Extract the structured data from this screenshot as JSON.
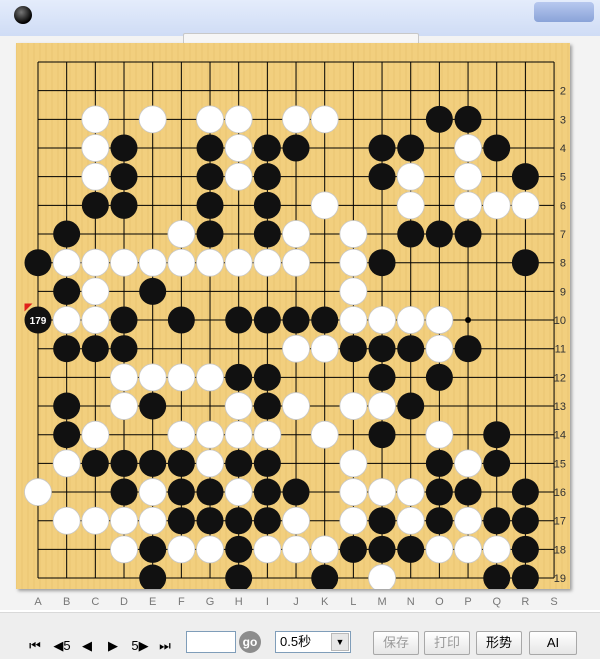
{
  "board": {
    "size": 19,
    "col_labels": [
      "A",
      "B",
      "C",
      "D",
      "E",
      "F",
      "G",
      "H",
      "I",
      "J",
      "K",
      "L",
      "M",
      "N",
      "O",
      "P",
      "Q",
      "R",
      "S"
    ],
    "row_labels_right": [
      "2",
      "3",
      "4",
      "5",
      "6",
      "7",
      "8",
      "9",
      "10",
      "11",
      "12",
      "13",
      "14",
      "15",
      "16",
      "17",
      "18",
      "19"
    ],
    "last_move_label": "179",
    "last_move": {
      "col": 1,
      "row": 10,
      "color": "black"
    },
    "marker_point": {
      "col": 16,
      "row": 10
    },
    "stone_rows": [
      "...................",
      "...................",
      "..W.W.WW.WW...BB...",
      "..WB..BWBB..BB.WB..",
      "..WB..BWB...BW.W.B.",
      "..BB..B.B.W..W.WWW.",
      ".B...WB.BW.W.BBB...",
      "BWWWWWWWWW.WB....B.",
      ".BW.B......W.......",
      ".WWB.B.BBBBWWWW....",
      ".BBB.....WWBBBWB...",
      "...WWWWBB...B.B....",
      ".B.WB..WBW.WWB.....",
      ".BW..WWWW.W.B.W.B..",
      ".WBBBBWBB..W..BWB..",
      "W..BWBBWBB.WWWBB.B.",
      ".WWWWBBBBW.WBWBWBB.",
      "...WBWWBWWWBBBWWWB.",
      "....B..B..B.W...BB."
    ]
  },
  "controls": {
    "first": "⏮",
    "back5": "◀5",
    "back1": "◀",
    "fwd1": "▶",
    "fwd5": "5▶",
    "last": "⏭",
    "move_number": "",
    "go": "go",
    "speed": "0.5秒",
    "save": "保存",
    "print": "打印",
    "situation": "形势",
    "ai": "AI"
  },
  "colors": {
    "board": "#f2cf7e",
    "grid": "#000000",
    "black_stone": "#111111",
    "white_stone": "#ffffff",
    "last_move_flag": "#e0201a"
  }
}
